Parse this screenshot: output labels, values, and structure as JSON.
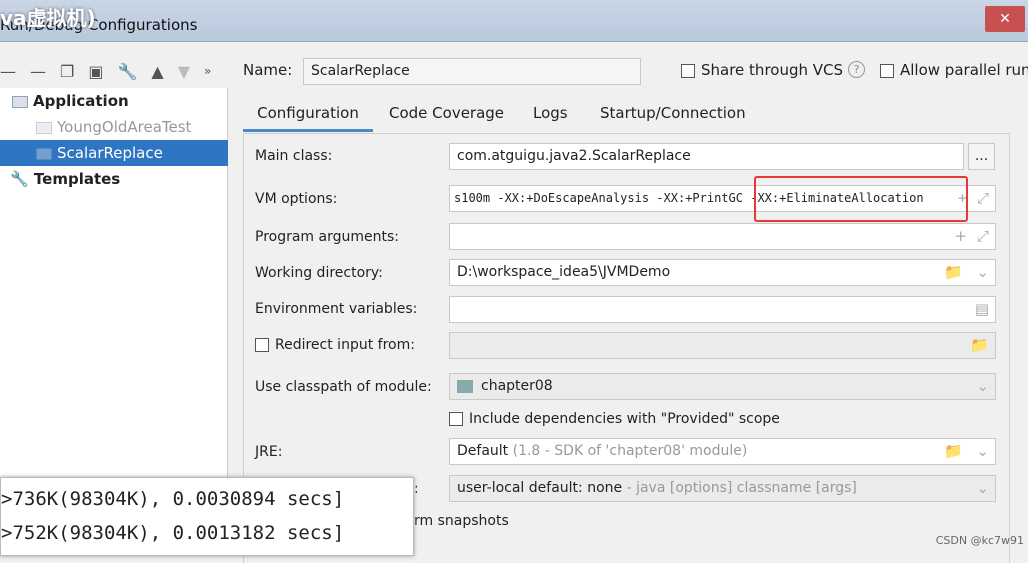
{
  "window": {
    "title": "Run/Debug Configurations",
    "overlay_text": "va虚拟机)",
    "close_label": "✕"
  },
  "toolbar": {
    "icons": [
      "minus-icon",
      "copy-icon",
      "save-icon",
      "wrench-icon",
      "arrow-up-icon",
      "arrow-down-icon",
      "more-icon"
    ]
  },
  "tree": {
    "items": [
      {
        "label": "Application"
      },
      {
        "label": "YoungOldAreaTest"
      },
      {
        "label": "ScalarReplace",
        "selected": true
      },
      {
        "label": "Templates"
      }
    ]
  },
  "name": {
    "label": "Name:",
    "value": "ScalarReplace",
    "share": "Share through VCS",
    "help": "?",
    "parallel": "Allow parallel run"
  },
  "tabs": [
    {
      "label": "Configuration",
      "active": true
    },
    {
      "label": "Code Coverage"
    },
    {
      "label": "Logs"
    },
    {
      "label": "Startup/Connection"
    }
  ],
  "form": {
    "main_class": {
      "label": "Main class:",
      "value": "com.atguigu.java2.ScalarReplace",
      "button": "..."
    },
    "vm_options": {
      "label": "VM options:",
      "value": "s100m -XX:+DoEscapeAnalysis -XX:+PrintGC",
      "highlight": "-XX:+EliminateAllocation"
    },
    "program_args": {
      "label": "Program arguments:",
      "value": ""
    },
    "working_dir": {
      "label": "Working directory:",
      "value": "D:\\workspace_idea5\\JVMDemo"
    },
    "env_vars": {
      "label": "Environment variables:",
      "value": ""
    },
    "redirect": {
      "label": "Redirect input from:",
      "value": ""
    },
    "classpath": {
      "label": "Use classpath of module:",
      "value": "chapter08"
    },
    "include_deps": {
      "label": "Include dependencies with \"Provided\" scope"
    },
    "jre": {
      "label": "JRE:",
      "value": "Default",
      "hint": "(1.8 - SDK of 'chapter08' module)"
    },
    "shorten": {
      "label": ":",
      "value": "user-local default: none",
      "hint": " - java [options] classname [args]"
    },
    "snapshots": {
      "label": "rm snapshots"
    }
  },
  "console": {
    "lines": [
      ">736K(98304K), 0.0030894 secs]",
      ">752K(98304K), 0.0013182 secs]"
    ]
  },
  "watermark": "CSDN @kc7w91",
  "colors": {
    "selection": "#2f76c2",
    "highlight_box": "#e53935",
    "tab_underline": "#4a88c7"
  }
}
